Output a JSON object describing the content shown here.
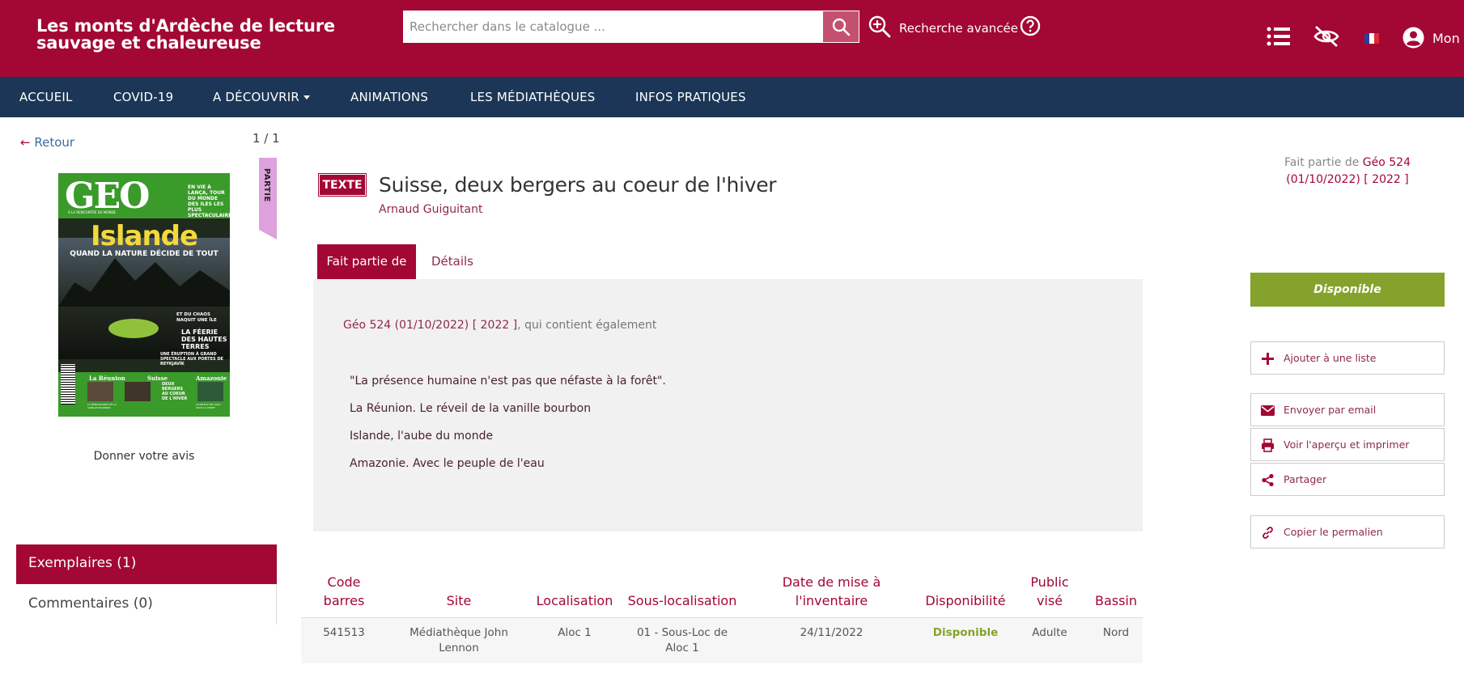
{
  "header": {
    "site_title": "Les monts d'Ardèche de lecture sauvage et chaleureuse",
    "search_placeholder": "Rechercher dans le catalogue ...",
    "advanced_search_label": "Recherche avancée",
    "account_label": "Mon c"
  },
  "nav": {
    "items": [
      "ACCUEIL",
      "COVID-19",
      "A DÉCOUVRIR",
      "ANIMATIONS",
      "LES MÉDIATHÈQUES",
      "INFOS PRATIQUES"
    ]
  },
  "left": {
    "back_label": "Retour",
    "pager": "1 / 1",
    "partie_label": "PARTIE",
    "cover": {
      "brand": "GEO",
      "subbrand": "À LA RENCONTRE DU MONDE",
      "headline": "Islande",
      "subhead": "QUAND LA NATURE DÉCIDE DE TOUT",
      "top_right": "EN VIE À LANÇA, TOUR DU MONDE DES ILES LES PLUS SPECTACULAIRES",
      "blurb1": "ET DU CHAOS NAQUIT UNE ÎLE",
      "blurb2": "LA FÉERIE DES HAUTES TERRES",
      "blurb3": "UNE ÉRUPTION À GRAND SPECTACLE AUX PORTES DE REYKJAVÍK",
      "bottom_labels": [
        "La Réunion",
        "Suisse",
        "Amazonie"
      ],
      "bottom_blurbs": [
        "LA RENAISSANCE DE LA VANILLE BOURBON",
        "DEUX BERGERS AU COEUR DE L'HIVER",
        "LE PEUPLE DE L'EAU SOUS LA FORÊT"
      ]
    },
    "review_label": "Donner votre avis",
    "tabs": {
      "copies": "Exemplaires (1)",
      "comments": "Commentaires (0)"
    }
  },
  "record": {
    "type_badge": "TEXTE",
    "title": "Suisse, deux bergers au coeur de l'hiver",
    "author": "Arnaud Guiguitant",
    "tabs": {
      "part_of": "Fait partie de",
      "details": "Détails"
    },
    "panel": {
      "parent_link": "Géo 524 (01/10/2022) [ 2022 ]",
      "parent_suffix": ", qui contient également",
      "items": [
        "\"La présence humaine n'est pas que néfaste à la forêt\".",
        "La Réunion. Le réveil de la vanille bourbon",
        "Islande, l'aube du monde",
        "Amazonie. Avec le peuple de l'eau"
      ]
    }
  },
  "copies_table": {
    "headers": [
      "Code barres",
      "Site",
      "Localisation",
      "Sous-localisation",
      "Date de mise à l'inventaire",
      "Disponibilité",
      "Public visé",
      "Bassin"
    ],
    "rows": [
      [
        "541513",
        "Médiathèque John Lennon",
        "Aloc 1",
        "01 - Sous-Loc de Aloc 1",
        "24/11/2022",
        "Disponible",
        "Adulte",
        "Nord"
      ]
    ]
  },
  "right": {
    "part_of_prefix": "Fait partie de",
    "part_of_link": "Géo 524 (01/10/2022) [ 2022 ]",
    "availability": "Disponible",
    "actions": [
      {
        "label": "Ajouter à une liste",
        "icon": "plus-icon"
      },
      {
        "label": "Envoyer par email",
        "icon": "envelope-icon"
      },
      {
        "label": "Voir l'aperçu et imprimer",
        "icon": "print-icon"
      },
      {
        "label": "Partager",
        "icon": "share-icon"
      },
      {
        "label": "Copier le permalien",
        "icon": "link-icon"
      }
    ]
  },
  "colors": {
    "brand": "#a30733",
    "nav": "#1b3657",
    "available": "#85a22c"
  }
}
